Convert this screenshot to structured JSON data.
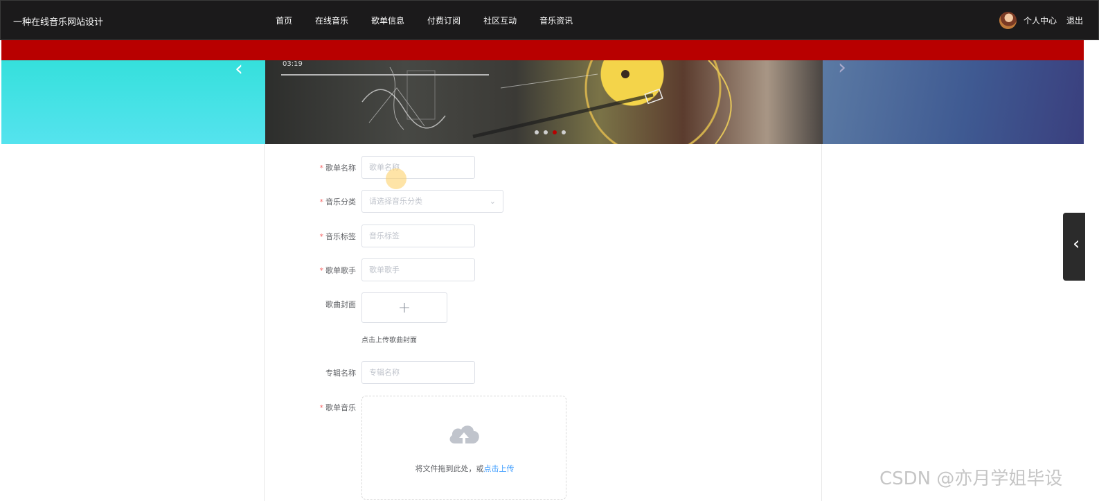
{
  "header": {
    "brand": "一种在线音乐网站设计",
    "nav": [
      "首页",
      "在线音乐",
      "歌单信息",
      "付费订阅",
      "社区互动",
      "音乐资讯"
    ],
    "user_center": "个人中心",
    "logout": "退出"
  },
  "banner": {
    "time": "03:19",
    "prev_glyph": "‹",
    "next_glyph": "›",
    "active_slide": 3,
    "slide_count": 4
  },
  "form": {
    "fields": [
      {
        "label": "歌单名称",
        "required": true,
        "placeholder": "歌单名称",
        "type": "input"
      },
      {
        "label": "音乐分类",
        "required": true,
        "placeholder": "请选择音乐分类",
        "type": "select"
      },
      {
        "label": "音乐标签",
        "required": true,
        "placeholder": "音乐标签",
        "type": "input"
      },
      {
        "label": "歌单歌手",
        "required": true,
        "placeholder": "歌单歌手",
        "type": "input"
      },
      {
        "label": "歌曲封面",
        "required": false,
        "type": "image-upload",
        "hint": "点击上传歌曲封面",
        "plus": "+"
      },
      {
        "label": "专辑名称",
        "required": false,
        "placeholder": "专辑名称",
        "type": "input"
      },
      {
        "label": "歌单音乐",
        "required": true,
        "type": "file-dragger",
        "drag_text": "将文件拖到此处，或",
        "click_text": "点击上传"
      }
    ],
    "required_mark": "*",
    "select_arrow": "⌄"
  },
  "side_tab": {
    "glyph": "‹"
  },
  "watermark": "CSDN @亦月学姐毕设",
  "colors": {
    "header_bg": "#1b1a1b",
    "red_bar": "#b80000",
    "required": "#f56c6c",
    "link": "#409eff"
  }
}
